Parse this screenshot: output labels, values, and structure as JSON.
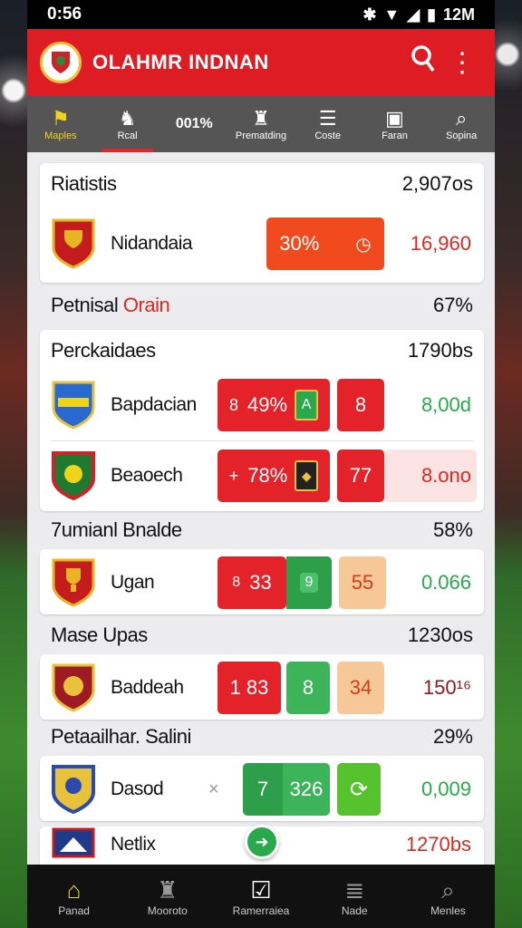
{
  "status": {
    "time": "0:56",
    "right_text": "12M"
  },
  "app": {
    "title": "OLAHMR INDNAN"
  },
  "tabs": [
    {
      "label": "Maples",
      "icon": "flag-icon"
    },
    {
      "label": "Rcal",
      "icon": "horse-icon"
    },
    {
      "label": "001%",
      "icon": ""
    },
    {
      "label": "Prematding",
      "icon": "trophy-icon"
    },
    {
      "label": "Coste",
      "icon": "list-icon"
    },
    {
      "label": "Faran",
      "icon": "box-icon"
    },
    {
      "label": "Sopina",
      "icon": "search-icon"
    }
  ],
  "sections": {
    "s1": {
      "title": "Riatistis",
      "value": "2,907os"
    },
    "s2": {
      "title": "Petnisal",
      "title_accent": "Orain",
      "value": "67%"
    },
    "s3": {
      "title": "Perckaidaes",
      "value": "1790bs"
    },
    "s4": {
      "title": "7umianl Bnalde",
      "value": "58%"
    },
    "s5": {
      "title": "Mase Upas",
      "value": "1230os"
    },
    "s6": {
      "title": "Petaailhar. Salini",
      "value": "29%"
    }
  },
  "rows": {
    "r1": {
      "team": "Nidandaia",
      "pill": "30%",
      "value": "16,960"
    },
    "r2": {
      "team": "Bapdacian",
      "pill1": "49%",
      "pill1_prefix": "8",
      "pill2": "8",
      "value": "8,00d"
    },
    "r3": {
      "team": "Beaoech",
      "pill1": "78%",
      "pill1_prefix": "+",
      "pill2": "77",
      "value": "8.ono"
    },
    "r4": {
      "team": "Ugan",
      "pill1": "33",
      "pill1_prefix": "8",
      "pill2": "9",
      "pill3": "55",
      "value": "0.066"
    },
    "r5": {
      "team": "Baddeah",
      "pill1": "1 83",
      "pill2": "8",
      "pill3": "34",
      "value": "150¹⁶"
    },
    "r6": {
      "team": "Dasod",
      "mark": "×",
      "pill1": "7",
      "pill2": "326",
      "value": "0,009"
    },
    "r7": {
      "team": "Netlix",
      "value": "1270bs"
    }
  },
  "bottom_nav": [
    {
      "label": "Panad",
      "icon": "home-icon"
    },
    {
      "label": "Mooroto",
      "icon": "graduation-icon"
    },
    {
      "label": "Ramerraiea",
      "icon": "check-icon"
    },
    {
      "label": "Nade",
      "icon": "stack-icon"
    },
    {
      "label": "Menles",
      "icon": "search-icon"
    }
  ],
  "colors": {
    "primary": "#dd1c24",
    "green": "#3db35a",
    "orange": "#f24a1f",
    "nav_active": "#e6dc1c"
  }
}
